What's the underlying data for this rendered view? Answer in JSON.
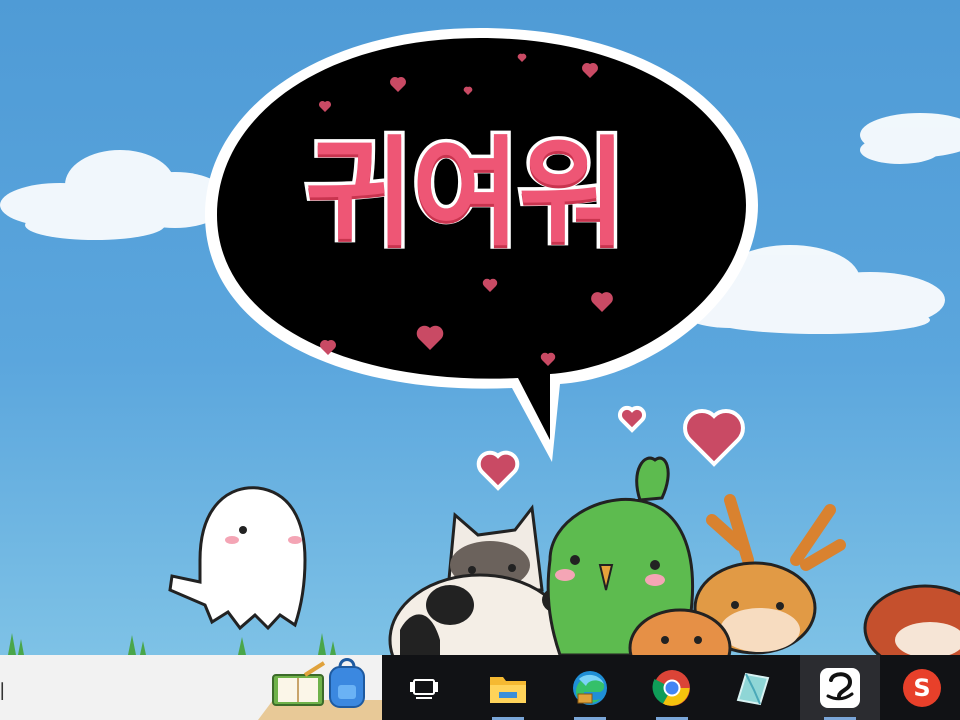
{
  "wallpaper": {
    "speech_bubble_text": "귀여워",
    "colors": {
      "sky": "#5ba6dd",
      "bubble": "#000000",
      "text": "#ee5675",
      "heart": "#c94a64"
    }
  },
  "taskbar": {
    "search_placeholder": "기",
    "search_highlight_icons": [
      "notebook-icon",
      "backpack-icon"
    ],
    "items": [
      {
        "name": "task-view",
        "icon": "task-view-icon"
      },
      {
        "name": "file-explorer",
        "icon": "folder-icon"
      },
      {
        "name": "microsoft-edge",
        "icon": "edge-icon"
      },
      {
        "name": "google-chrome",
        "icon": "chrome-icon"
      },
      {
        "name": "app-crystal",
        "icon": "crystal-icon"
      },
      {
        "name": "clip-studio",
        "icon": "clip-studio-icon"
      },
      {
        "name": "app-s",
        "icon": "s-app-icon",
        "label": "S"
      }
    ]
  }
}
